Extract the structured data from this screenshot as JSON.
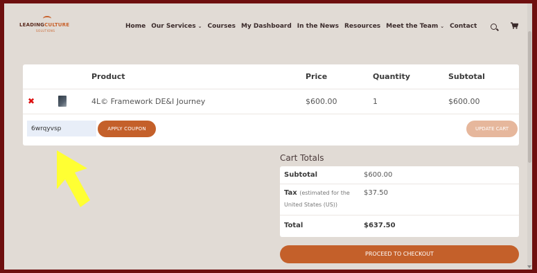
{
  "logo": {
    "word_main": "LEADING",
    "word_accent": "CULTURE",
    "tagline": "SOLUTIONS"
  },
  "nav": {
    "items": [
      {
        "label": "Home",
        "dropdown": false
      },
      {
        "label": "Our Services",
        "dropdown": true
      },
      {
        "label": "Courses",
        "dropdown": false
      },
      {
        "label": "My Dashboard",
        "dropdown": false
      },
      {
        "label": "In the News",
        "dropdown": false
      },
      {
        "label": "Resources",
        "dropdown": false
      },
      {
        "label": "Meet the Team",
        "dropdown": true
      },
      {
        "label": "Contact",
        "dropdown": false
      }
    ],
    "search_icon": "search-icon",
    "cart_icon": "cart-icon"
  },
  "cart": {
    "headers": {
      "product": "Product",
      "price": "Price",
      "quantity": "Quantity",
      "subtotal": "Subtotal"
    },
    "items": [
      {
        "remove": "✖",
        "name": "4L© Framework DE&I Journey",
        "price": "$600.00",
        "quantity": "1",
        "subtotal": "$600.00"
      }
    ],
    "coupon_value": "6wrqyvsp",
    "apply_label": "APPLY COUPON",
    "update_label": "UPDATE CART"
  },
  "totals": {
    "title": "Cart Totals",
    "subtotal_label": "Subtotal",
    "subtotal_value": "$600.00",
    "tax_label": "Tax",
    "tax_note_1": "(estimated for the",
    "tax_note_2": "United States (US))",
    "tax_value": "$37.50",
    "total_label": "Total",
    "total_value": "$637.50",
    "checkout_label": "PROCEED TO CHECKOUT"
  },
  "colors": {
    "brand": "#c4602a",
    "frame": "#6e0f0f",
    "page_bg": "#e1dbd5",
    "arrow": "#ffff33"
  }
}
